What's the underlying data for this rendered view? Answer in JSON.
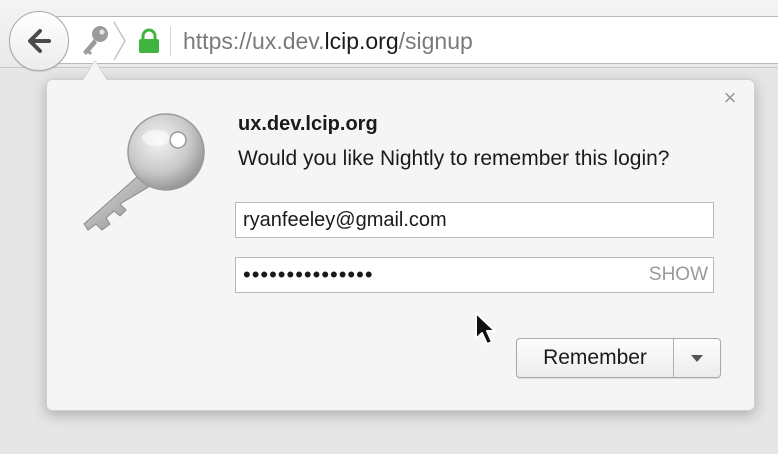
{
  "urlbar": {
    "url_prefix": "https://ux.dev.",
    "url_host": "lcip.org",
    "url_path": "/signup"
  },
  "panel": {
    "site": "ux.dev.lcip.org",
    "prompt": "Would you like Nightly to remember this login?",
    "close_label": "×",
    "username": "ryanfeeley@gmail.com",
    "password_masked": "•••••••••••••••",
    "show_label": "SHOW",
    "remember_label": "Remember"
  },
  "icons": {
    "back": "back-arrow-icon",
    "key_small": "key-icon",
    "lock": "lock-icon",
    "key_large": "key-icon",
    "dropdown": "dropdown-arrow-icon",
    "cursor": "mouse-cursor-icon"
  },
  "colors": {
    "lock_green": "#3fb53f",
    "text": "#1a1a1a",
    "muted": "#9a9a9a"
  }
}
